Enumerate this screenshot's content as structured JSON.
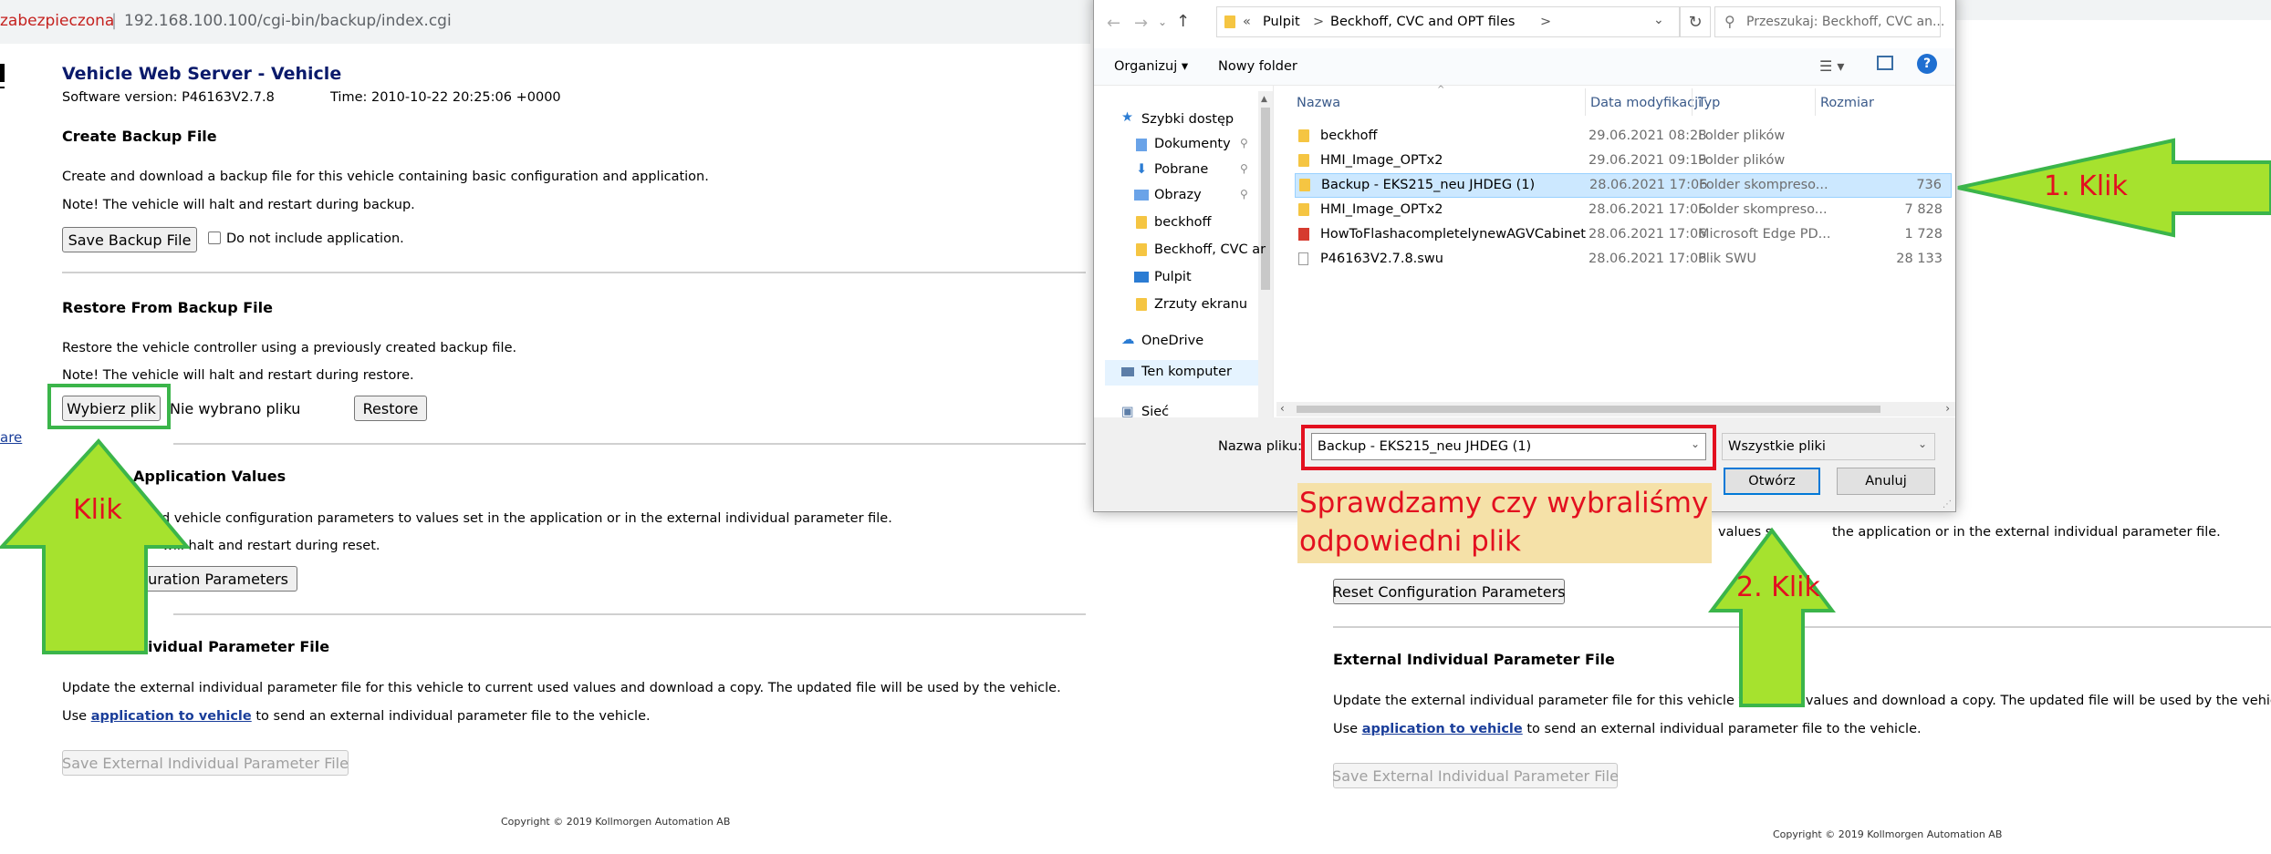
{
  "browser": {
    "insecure_label": "zabezpieczona",
    "url": "192.168.100.100/cgi-bin/backup/index.cgi"
  },
  "page": {
    "title": "Vehicle Web Server - Vehicle",
    "software_version": "Software version: P46163V2.7.8",
    "time": "Time: 2010-10-22 20:25:06 +0000",
    "left_link_fragment": "are",
    "create_backup": {
      "heading": "Create Backup File",
      "desc": "Create and download a backup file for this vehicle containing basic configuration and application.",
      "note": "Note! The vehicle will halt and restart during backup.",
      "save_button": "Save Backup File",
      "checkbox_label": "Do not include application."
    },
    "restore": {
      "heading": "Restore From Backup File",
      "desc": "Restore the vehicle controller using a previously created backup file.",
      "note": "Note! The vehicle will halt and restart during restore.",
      "choose_button": "Wybierz plik",
      "no_file": "Nie wybrano pliku",
      "restore_button": "Restore"
    },
    "reset": {
      "heading_fragment": "Application Values",
      "desc_fragment": "ied vehicle configuration parameters to values set in the application or in the external individual parameter file.",
      "note_fragment": "will halt and restart during reset.",
      "button_fragment": "guration Parameters"
    },
    "external": {
      "heading_fragment": "ividual Parameter File",
      "desc": "Update the external individual parameter file for this vehicle to current used values and download a copy. The updated file will be used by the vehicle.",
      "use_prefix": "Use",
      "link": "application to vehicle",
      "use_suffix": "to send an external individual parameter file to the vehicle.",
      "save_button": "Save External Individual Parameter File"
    },
    "copyright": "Copyright © 2019 Kollmorgen Automation AB"
  },
  "right_page": {
    "reset_desc_fragment": "values s",
    "reset_desc_fragment2": "the application or in the external individual parameter file.",
    "reset_button": "Reset Configuration Parameters",
    "external_heading": "External Individual Parameter File",
    "external_desc_part1": "Update the external individual parameter file for this vehicle to c",
    "external_desc_part2": "d values and download a copy. The updated file will be used by the vehicl",
    "use_prefix": "Use",
    "link": "application to vehicle",
    "use_suffix": "to send an external individual parameter file to the vehicle.",
    "save_button": "Save External Individual Parameter File",
    "copyright": "Copyright © 2019 Kollmorgen Automation AB"
  },
  "dialog": {
    "breadcrumb": [
      "«",
      "Pulpit",
      ">",
      "Beckhoff, CVC and OPT files",
      ">"
    ],
    "search_placeholder": "Przeszukaj: Beckhoff, CVC an...",
    "organize": "Organizuj ▾",
    "new_folder": "Nowy folder",
    "nav_items": [
      {
        "label": "Szybki dostęp",
        "icon": "star-icon"
      },
      {
        "label": "Dokumenty",
        "icon": "documents-icon"
      },
      {
        "label": "Pobrane",
        "icon": "download-icon"
      },
      {
        "label": "Obrazy",
        "icon": "pictures-icon"
      },
      {
        "label": "beckhoff",
        "icon": "folder-icon"
      },
      {
        "label": "Beckhoff, CVC ar",
        "icon": "folder-icon"
      },
      {
        "label": "Pulpit",
        "icon": "desktop-icon"
      },
      {
        "label": "Zrzuty ekranu",
        "icon": "folder-icon"
      },
      {
        "label": "OneDrive",
        "icon": "cloud-icon"
      },
      {
        "label": "Ten komputer",
        "icon": "computer-icon"
      },
      {
        "label": "Sieć",
        "icon": "network-icon"
      }
    ],
    "columns": [
      "Nazwa",
      "Data modyfikacji",
      "Typ",
      "Rozmiar"
    ],
    "files": [
      {
        "name": "beckhoff",
        "date": "29.06.2021 08:28",
        "type": "Folder plików",
        "size": "",
        "icon": "folder-icon"
      },
      {
        "name": "HMI_Image_OPTx2",
        "date": "29.06.2021 09:19",
        "type": "Folder plików",
        "size": "",
        "icon": "folder-icon"
      },
      {
        "name": "Backup - EKS215_neu JHDEG (1)",
        "date": "28.06.2021 17:06",
        "type": "Folder skompreso...",
        "size": "736",
        "icon": "zip-folder-icon",
        "selected": true
      },
      {
        "name": "HMI_Image_OPTx2",
        "date": "28.06.2021 17:06",
        "type": "Folder skompreso...",
        "size": "7 828",
        "icon": "zip-folder-icon"
      },
      {
        "name": "HowToFlashacompletelynewAGVCabinet",
        "date": "28.06.2021 17:06",
        "type": "Microsoft Edge PD...",
        "size": "1 728",
        "icon": "pdf-icon"
      },
      {
        "name": "P46163V2.7.8.swu",
        "date": "28.06.2021 17:06",
        "type": "Plik SWU",
        "size": "28 133",
        "icon": "file-icon"
      }
    ],
    "filename_label": "Nazwa pliku:",
    "filename_value": "Backup - EKS215_neu JHDEG (1)",
    "filter_value": "Wszystkie pliki",
    "open_button": "Otwórz",
    "cancel_button": "Anuluj"
  },
  "annotations": {
    "note_line1": "Sprawdzamy czy wybraliśmy",
    "note_line2": "odpowiedni plik",
    "klik_left": "Klik",
    "klik_1": "1. Klik",
    "klik_2": "2. Klik",
    "arrow_color": "#a6e22e",
    "arrow_border": "#3bb54a",
    "highlight_green": "#3bb54a",
    "highlight_red": "#e3101f"
  }
}
